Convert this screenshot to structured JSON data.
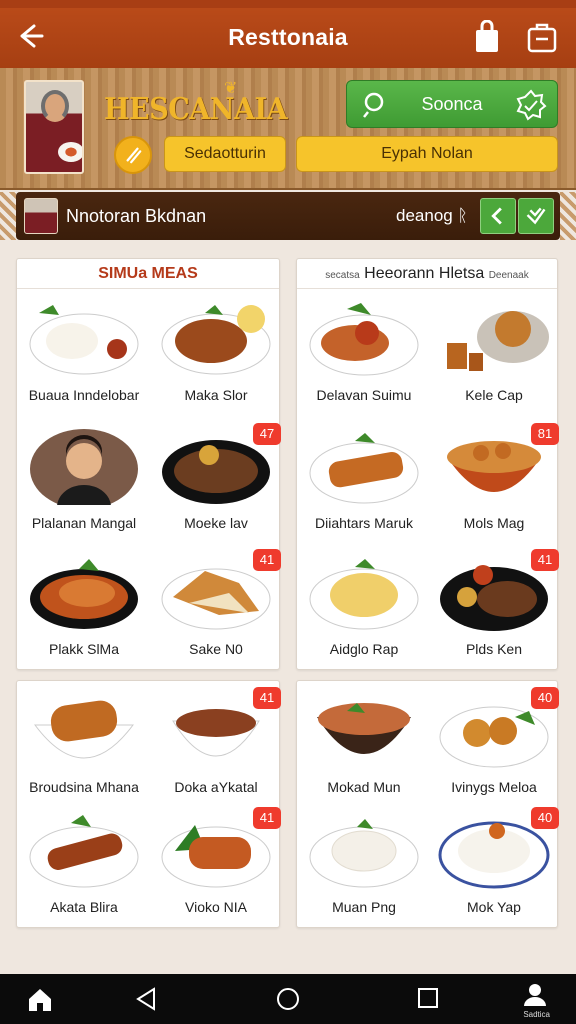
{
  "header": {
    "title": "Resttonaia"
  },
  "hero": {
    "brand": "HESCANAIA",
    "green_button": "Soonca",
    "yellow_button_1": "Sedaotturin",
    "yellow_button_2": "Eypah Nolan"
  },
  "info_bar": {
    "name": "Nnotoran Bkdnan",
    "count": "deanog ᚱ"
  },
  "card1": {
    "title": "SIMUa MEAS",
    "items": [
      {
        "label": "Buaua Inndelobar",
        "badge": ""
      },
      {
        "label": "Maka Slor",
        "badge": ""
      },
      {
        "label": "Plalanan Mangal",
        "badge": ""
      },
      {
        "label": "Moeke lav",
        "badge": "47"
      },
      {
        "label": "Plakk SlMa",
        "badge": ""
      },
      {
        "label": "Sake N0",
        "badge": "41"
      }
    ]
  },
  "card2": {
    "title_small_left": "secatsa",
    "title": "Heeorann Hletsa",
    "title_small_right": "Deenaak",
    "items": [
      {
        "label": "Delavan Suimu",
        "badge": ""
      },
      {
        "label": "Kele Cap",
        "badge": ""
      },
      {
        "label": "Diiahtars Maruk",
        "badge": ""
      },
      {
        "label": "Mols Mag",
        "badge": "81"
      },
      {
        "label": "Aidglo Rap",
        "badge": ""
      },
      {
        "label": "Plds Ken",
        "badge": "41"
      }
    ]
  },
  "card3": {
    "items": [
      {
        "label": "Broudsina Mhana",
        "badge": ""
      },
      {
        "label": "Doka aYkatal",
        "badge": "41"
      },
      {
        "label": "Akata Blira",
        "badge": ""
      },
      {
        "label": "Vioko NIA",
        "badge": "41"
      }
    ]
  },
  "card4": {
    "items": [
      {
        "label": "Mokad Mun",
        "badge": ""
      },
      {
        "label": "Ivinygs Meloa",
        "badge": "40"
      },
      {
        "label": "Muan Png",
        "badge": ""
      },
      {
        "label": "Mok Yap",
        "badge": "40"
      }
    ]
  },
  "nav": {
    "profile_label": "Sadtica"
  },
  "colors": {
    "header": "#b04415",
    "accent_green": "#4ca83b",
    "accent_yellow": "#f6c42b",
    "badge_red": "#ef3b2d"
  }
}
